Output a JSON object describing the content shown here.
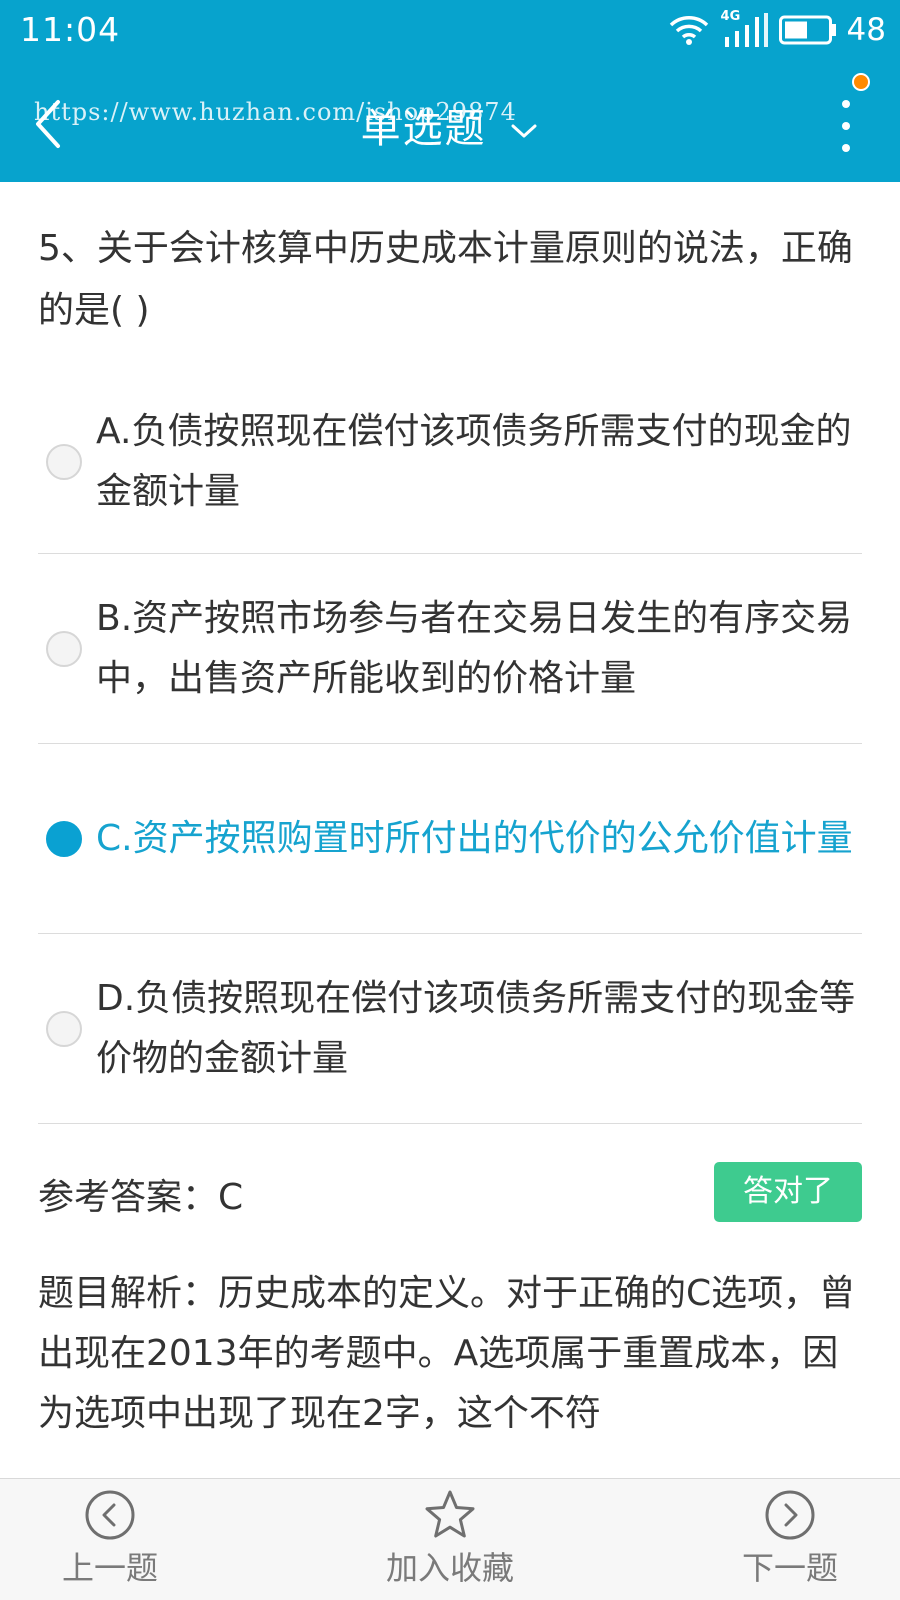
{
  "status_bar": {
    "time": "11:04",
    "network": "4G",
    "battery": "48"
  },
  "header": {
    "title": "单选题",
    "watermark": "https://www.huzhan.com/ishop29874",
    "bg_color": "#07a3cd",
    "notification_color": "#ff8a00"
  },
  "question": {
    "text": "5、关于会计核算中历史成本计量原则的说法，正确的是( )"
  },
  "options": [
    {
      "label": "A.负债按照现在偿付该项债务所需支付的现金的金额计量",
      "selected": false
    },
    {
      "label": "B.资产按照市场参与者在交易日发生的有序交易中，出售资产所能收到的价格计量",
      "selected": false
    },
    {
      "label": "C.资产按照购置时所付出的代价的公允价值计量",
      "selected": true
    },
    {
      "label": "D.负债按照现在偿付该项债务所需支付的现金等价物的金额计量",
      "selected": false
    }
  ],
  "answer": {
    "label": "参考答案：C",
    "result_badge": "答对了",
    "badge_color": "#3ecb8f"
  },
  "analysis": {
    "text": "题目解析：历史成本的定义。对于正确的C选项，曾出现在2013年的考题中。A选项属于重置成本，因为选项中出现了现在2字，这个不符"
  },
  "bottom_nav": {
    "prev": "上一题",
    "favorite": "加入收藏",
    "next": "下一题"
  },
  "icons": {
    "back": "chevron-left-icon",
    "dropdown": "chevron-down-icon",
    "more": "more-vertical-icon",
    "prev": "circle-chevron-left-icon",
    "favorite": "star-icon",
    "next": "circle-chevron-right-icon"
  }
}
